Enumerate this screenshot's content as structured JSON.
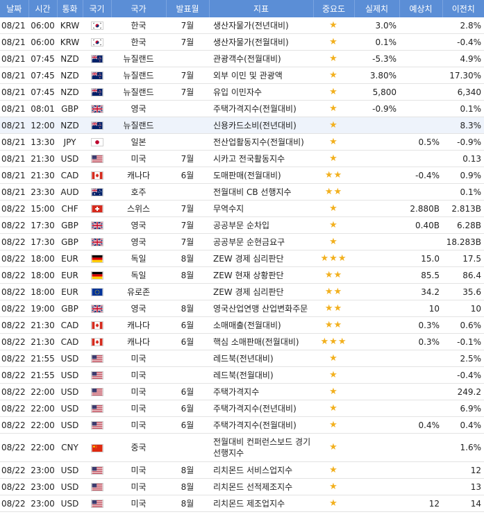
{
  "headers": [
    "날짜",
    "시간",
    "통화",
    "국기",
    "국가",
    "발표월",
    "지표",
    "중요도",
    "실제치",
    "예상치",
    "이전치"
  ],
  "rows": [
    {
      "date": "08/21",
      "time": "06:00",
      "currency": "KRW",
      "flag": "kr",
      "country": "한국",
      "period": "7월",
      "indicator": "생산자물가(전년대비)",
      "importance": 1,
      "actual": "3.0%",
      "forecast": "",
      "previous": "2.8%"
    },
    {
      "date": "08/21",
      "time": "06:00",
      "currency": "KRW",
      "flag": "kr",
      "country": "한국",
      "period": "7월",
      "indicator": "생산자물가(전월대비)",
      "importance": 1,
      "actual": "0.1%",
      "forecast": "",
      "previous": "-0.4%"
    },
    {
      "date": "08/21",
      "time": "07:45",
      "currency": "NZD",
      "flag": "nz",
      "country": "뉴질랜드",
      "period": "",
      "indicator": "관광객수(전월대비)",
      "importance": 1,
      "actual": "-5.3%",
      "forecast": "",
      "previous": "4.9%"
    },
    {
      "date": "08/21",
      "time": "07:45",
      "currency": "NZD",
      "flag": "nz",
      "country": "뉴질랜드",
      "period": "7월",
      "indicator": "외부 이민 및 관광액",
      "importance": 1,
      "actual": "3.80%",
      "forecast": "",
      "previous": "17.30%"
    },
    {
      "date": "08/21",
      "time": "07:45",
      "currency": "NZD",
      "flag": "nz",
      "country": "뉴질랜드",
      "period": "7월",
      "indicator": "유입 이민자수",
      "importance": 1,
      "actual": "5,800",
      "forecast": "",
      "previous": "6,340"
    },
    {
      "date": "08/21",
      "time": "08:01",
      "currency": "GBP",
      "flag": "gb",
      "country": "영국",
      "period": "",
      "indicator": "주택가격지수(전월대비)",
      "importance": 1,
      "actual": "-0.9%",
      "forecast": "",
      "previous": "0.1%"
    },
    {
      "date": "08/21",
      "time": "12:00",
      "currency": "NZD",
      "flag": "nz",
      "country": "뉴질랜드",
      "period": "",
      "indicator": "신용카드소비(전년대비)",
      "importance": 1,
      "actual": "",
      "forecast": "",
      "previous": "8.3%",
      "highlight": true
    },
    {
      "date": "08/21",
      "time": "13:30",
      "currency": "JPY",
      "flag": "jp",
      "country": "일본",
      "period": "",
      "indicator": "전산업활동지수(전월대비)",
      "importance": 1,
      "actual": "",
      "forecast": "0.5%",
      "previous": "-0.9%"
    },
    {
      "date": "08/21",
      "time": "21:30",
      "currency": "USD",
      "flag": "us",
      "country": "미국",
      "period": "7월",
      "indicator": "시카고 전국활동지수",
      "importance": 1,
      "actual": "",
      "forecast": "",
      "previous": "0.13"
    },
    {
      "date": "08/21",
      "time": "21:30",
      "currency": "CAD",
      "flag": "ca",
      "country": "캐나다",
      "period": "6월",
      "indicator": "도매판매(전월대비)",
      "importance": 2,
      "actual": "",
      "forecast": "-0.4%",
      "previous": "0.9%"
    },
    {
      "date": "08/21",
      "time": "23:30",
      "currency": "AUD",
      "flag": "au",
      "country": "호주",
      "period": "",
      "indicator": "전월대비 CB 선행지수",
      "importance": 2,
      "actual": "",
      "forecast": "",
      "previous": "0.1%"
    },
    {
      "date": "08/22",
      "time": "15:00",
      "currency": "CHF",
      "flag": "ch",
      "country": "스위스",
      "period": "7월",
      "indicator": "무역수지",
      "importance": 1,
      "actual": "",
      "forecast": "2.880B",
      "previous": "2.813B"
    },
    {
      "date": "08/22",
      "time": "17:30",
      "currency": "GBP",
      "flag": "gb",
      "country": "영국",
      "period": "7월",
      "indicator": "공공부문 순차입",
      "importance": 1,
      "actual": "",
      "forecast": "0.40B",
      "previous": "6.28B"
    },
    {
      "date": "08/22",
      "time": "17:30",
      "currency": "GBP",
      "flag": "gb",
      "country": "영국",
      "period": "7월",
      "indicator": "공공부문 순현금요구",
      "importance": 1,
      "actual": "",
      "forecast": "",
      "previous": "18.283B"
    },
    {
      "date": "08/22",
      "time": "18:00",
      "currency": "EUR",
      "flag": "de",
      "country": "독일",
      "period": "8월",
      "indicator": "ZEW 경제 심리판단",
      "importance": 3,
      "actual": "",
      "forecast": "15.0",
      "previous": "17.5"
    },
    {
      "date": "08/22",
      "time": "18:00",
      "currency": "EUR",
      "flag": "de",
      "country": "독일",
      "period": "8월",
      "indicator": "ZEW 현재 상황판단",
      "importance": 2,
      "actual": "",
      "forecast": "85.5",
      "previous": "86.4"
    },
    {
      "date": "08/22",
      "time": "18:00",
      "currency": "EUR",
      "flag": "eu",
      "country": "유로존",
      "period": "",
      "indicator": "ZEW 경제 심리판단",
      "importance": 2,
      "actual": "",
      "forecast": "34.2",
      "previous": "35.6"
    },
    {
      "date": "08/22",
      "time": "19:00",
      "currency": "GBP",
      "flag": "gb",
      "country": "영국",
      "period": "8월",
      "indicator": "영국산업연맹 산업변화주문",
      "importance": 2,
      "actual": "",
      "forecast": "10",
      "previous": "10"
    },
    {
      "date": "08/22",
      "time": "21:30",
      "currency": "CAD",
      "flag": "ca",
      "country": "캐나다",
      "period": "6월",
      "indicator": "소매매출(전월대비)",
      "importance": 2,
      "actual": "",
      "forecast": "0.3%",
      "previous": "0.6%"
    },
    {
      "date": "08/22",
      "time": "21:30",
      "currency": "CAD",
      "flag": "ca",
      "country": "캐나다",
      "period": "6월",
      "indicator": "핵심 소매판매(전월대비)",
      "importance": 3,
      "actual": "",
      "forecast": "0.3%",
      "previous": "-0.1%"
    },
    {
      "date": "08/22",
      "time": "21:55",
      "currency": "USD",
      "flag": "us",
      "country": "미국",
      "period": "",
      "indicator": "레드북(전년대비)",
      "importance": 1,
      "actual": "",
      "forecast": "",
      "previous": "2.5%"
    },
    {
      "date": "08/22",
      "time": "21:55",
      "currency": "USD",
      "flag": "us",
      "country": "미국",
      "period": "",
      "indicator": "레드북(전월대비)",
      "importance": 1,
      "actual": "",
      "forecast": "",
      "previous": "-0.4%"
    },
    {
      "date": "08/22",
      "time": "22:00",
      "currency": "USD",
      "flag": "us",
      "country": "미국",
      "period": "6월",
      "indicator": "주택가격지수",
      "importance": 1,
      "actual": "",
      "forecast": "",
      "previous": "249.2"
    },
    {
      "date": "08/22",
      "time": "22:00",
      "currency": "USD",
      "flag": "us",
      "country": "미국",
      "period": "6월",
      "indicator": "주택가격지수(전년대비)",
      "importance": 1,
      "actual": "",
      "forecast": "",
      "previous": "6.9%"
    },
    {
      "date": "08/22",
      "time": "22:00",
      "currency": "USD",
      "flag": "us",
      "country": "미국",
      "period": "6월",
      "indicator": "주택가격지수(전월대비)",
      "importance": 1,
      "actual": "",
      "forecast": "0.4%",
      "previous": "0.4%"
    },
    {
      "date": "08/22",
      "time": "22:00",
      "currency": "CNY",
      "flag": "cn",
      "country": "중국",
      "period": "",
      "indicator": "전월대비 컨퍼런스보드 경기선행지수",
      "importance": 1,
      "actual": "",
      "forecast": "",
      "previous": "1.6%",
      "tall": true
    },
    {
      "date": "08/22",
      "time": "23:00",
      "currency": "USD",
      "flag": "us",
      "country": "미국",
      "period": "8월",
      "indicator": "리치몬드 서비스업지수",
      "importance": 1,
      "actual": "",
      "forecast": "",
      "previous": "12"
    },
    {
      "date": "08/22",
      "time": "23:00",
      "currency": "USD",
      "flag": "us",
      "country": "미국",
      "period": "8월",
      "indicator": "리치몬드 선적제조지수",
      "importance": 1,
      "actual": "",
      "forecast": "",
      "previous": "13"
    },
    {
      "date": "08/22",
      "time": "23:00",
      "currency": "USD",
      "flag": "us",
      "country": "미국",
      "period": "8월",
      "indicator": "리치몬드 제조업지수",
      "importance": 1,
      "actual": "",
      "forecast": "12",
      "previous": "14"
    }
  ],
  "colors": {
    "header": "#5b8ed6",
    "star": "#f2b01e",
    "highlight": "#eef3fb"
  }
}
